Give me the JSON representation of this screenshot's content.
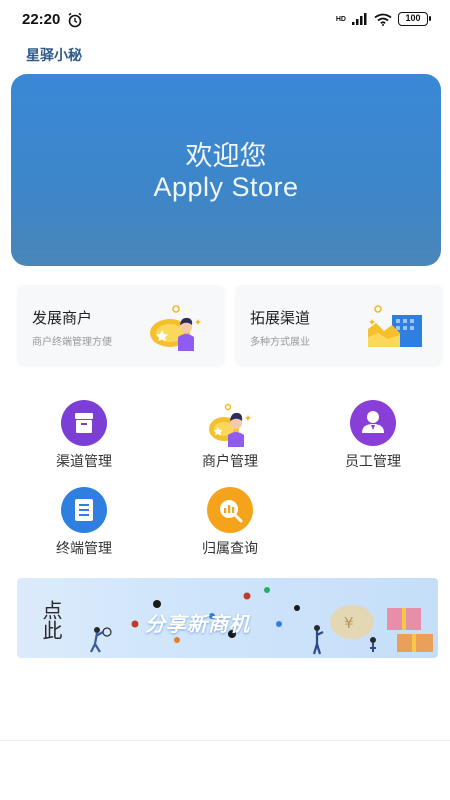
{
  "status_bar": {
    "time": "22:20",
    "network": "HD",
    "battery": "100"
  },
  "app": {
    "title": "星驿小秘"
  },
  "hero": {
    "line1": "欢迎您",
    "line2": "Apply Store"
  },
  "cards": [
    {
      "title": "发展商户",
      "subtitle": "商户终端管理方便",
      "icon": "merchant-person-icon"
    },
    {
      "title": "拓展渠道",
      "subtitle": "多种方式展业",
      "icon": "channel-building-icon"
    }
  ],
  "menu": [
    {
      "label": "渠道管理",
      "icon": "box-icon",
      "color": "#7b3fd6"
    },
    {
      "label": "商户管理",
      "icon": "merchant-icon",
      "color": "#f5b81c"
    },
    {
      "label": "员工管理",
      "icon": "staff-icon",
      "color": "#8a3ed8"
    },
    {
      "label": "终端管理",
      "icon": "document-icon",
      "color": "#2e7fe0"
    },
    {
      "label": "归属查询",
      "icon": "search-chart-icon",
      "color": "#f5a31a"
    }
  ],
  "promo": {
    "text": "分享新商机",
    "calligraphy": "点此"
  },
  "colors": {
    "hero_start": "#3a88d6",
    "hero_end": "#4a86b8",
    "app_title": "#2c5a8a"
  }
}
